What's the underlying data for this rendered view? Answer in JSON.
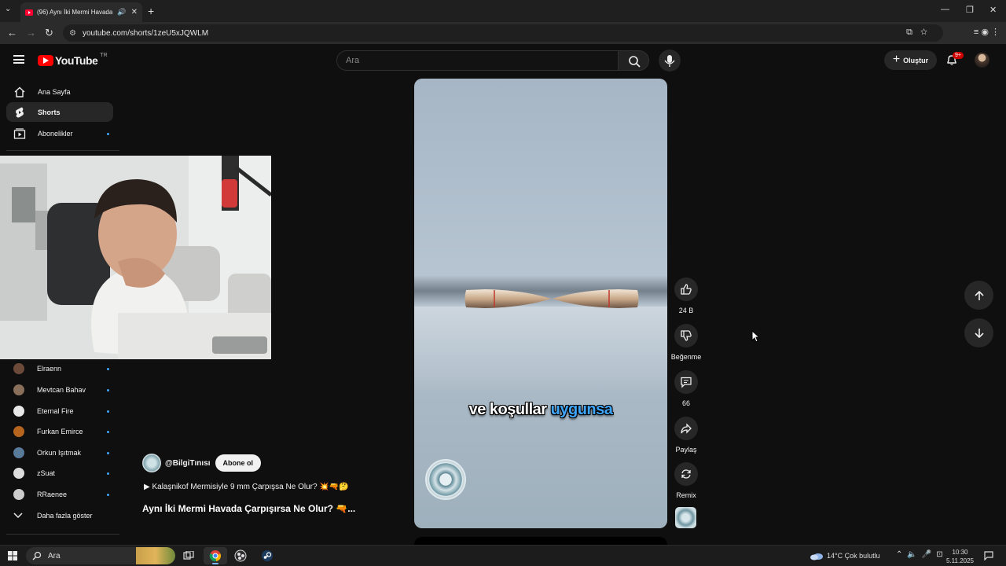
{
  "browser": {
    "tab_title": "(96) Aynı İki Mermi Havada",
    "url": "youtube.com/shorts/1zeU5xJQWLM"
  },
  "youtube": {
    "logo_text": "YouTube",
    "region": "TR",
    "search_placeholder": "Ara",
    "create_label": "Oluştur",
    "notif_count": "9+"
  },
  "sidebar": {
    "nav": [
      {
        "label": "Ana Sayfa"
      },
      {
        "label": "Shorts"
      },
      {
        "label": "Abonelikler"
      }
    ],
    "subscriptions": [
      {
        "name": "Elraenn",
        "color": "#6b4a3a"
      },
      {
        "name": "Mevtcan Bahav",
        "color": "#8a6f5a"
      },
      {
        "name": "Eternal Fire",
        "color": "#e8e8e8"
      },
      {
        "name": "Furkan Emirce",
        "color": "#b5651d"
      },
      {
        "name": "Orkun Işıtmak",
        "color": "#5a7a9a"
      },
      {
        "name": "zSuat",
        "color": "#dddddd"
      },
      {
        "name": "RRaenee",
        "color": "#cccccc"
      }
    ],
    "show_more": "Daha fazla göster"
  },
  "short": {
    "channel": "@BilgiTınısı",
    "subscribe": "Abone ol",
    "link": "▶ Kalaşnikof Mermisiyle 9 mm Çarpışsa Ne Olur? 💥🔫🤔",
    "title": "Aynı İki Mermi Havada Çarpışırsa Ne Olur? 🔫...",
    "caption_white": "ve koşullar",
    "caption_blue": "uygunsa"
  },
  "actions": {
    "likes": "24 B",
    "dislike": "Beğenme",
    "comments": "66",
    "share": "Paylaş",
    "remix": "Remix"
  },
  "taskbar": {
    "search": "Ara",
    "weather": "14°C  Çok bulutlu",
    "time": "10:30",
    "date": "5.11.2025"
  }
}
